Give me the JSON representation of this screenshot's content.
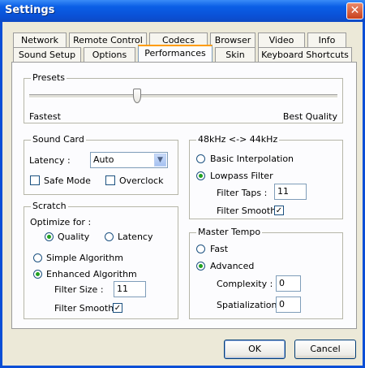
{
  "window": {
    "title": "Settings",
    "close_glyph": "✕"
  },
  "tabs_top": [
    "Network",
    "Remote Control",
    "Codecs",
    "Browser",
    "Video",
    "Info"
  ],
  "tabs_bottom": [
    "Sound Setup",
    "Options",
    "Performances",
    "Skin",
    "Keyboard Shortcuts"
  ],
  "active_tab": "Performances",
  "presets": {
    "legend": "Presets",
    "min_label": "Fastest",
    "max_label": "Best Quality",
    "level": 0.35
  },
  "sound_card": {
    "legend": "Sound Card",
    "latency_label": "Latency :",
    "latency_value": "Auto",
    "safe_mode_label": "Safe Mode",
    "safe_mode_checked": false,
    "overclock_label": "Overclock",
    "overclock_checked": false
  },
  "scratch": {
    "legend": "Scratch",
    "optimize_label": "Optimize for :",
    "quality_label": "Quality",
    "latency_label": "Latency",
    "optimize_selected": "Quality",
    "simple_label": "Simple Algorithm",
    "enhanced_label": "Enhanced Algorithm",
    "algorithm_selected": "Enhanced Algorithm",
    "filter_size_label": "Filter Size :",
    "filter_size_value": "11",
    "filter_smooth_label": "Filter Smooth",
    "filter_smooth_checked": true
  },
  "resample": {
    "legend": "48kHz <-> 44kHz",
    "basic_label": "Basic Interpolation",
    "lowpass_label": "Lowpass Filter",
    "selected": "Lowpass Filter",
    "filter_taps_label": "Filter Taps :",
    "filter_taps_value": "11",
    "filter_smooth_label": "Filter Smooth",
    "filter_smooth_checked": true
  },
  "master_tempo": {
    "legend": "Master Tempo",
    "fast_label": "Fast",
    "advanced_label": "Advanced",
    "selected": "Advanced",
    "complexity_label": "Complexity :",
    "complexity_value": "0",
    "spatialization_label": "Spatialization :",
    "spatialization_value": "0"
  },
  "buttons": {
    "ok": "OK",
    "cancel": "Cancel"
  },
  "icons": {
    "checkmark": "✓",
    "dropdown_arrow": "▼"
  }
}
